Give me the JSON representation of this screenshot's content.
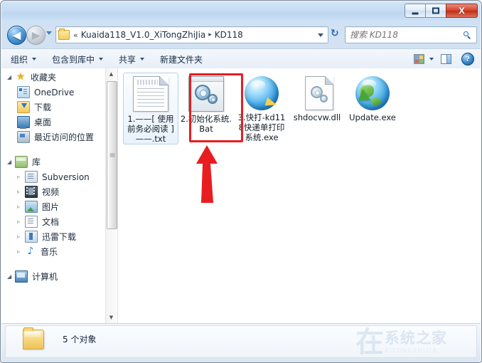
{
  "window": {
    "title": "",
    "controls": {
      "minimize": "–",
      "maximize": "□",
      "close": "X"
    }
  },
  "address_bar": {
    "back_tooltip": "←",
    "back_glyph": "◀",
    "forward_glyph": "▶",
    "history_dropdown": "▼",
    "breadcrumb_prefix": "«",
    "breadcrumb": [
      "Kuaida118_V1.0_XiTongZhiJia",
      "KD118"
    ],
    "breadcrumb_separator": "▸",
    "refresh_glyph": "↻",
    "search": {
      "placeholder": "搜索 KD118",
      "value": ""
    }
  },
  "toolbar": {
    "items": [
      {
        "label": "组织",
        "has_dropdown": true
      },
      {
        "label": "包含到库中",
        "has_dropdown": true
      },
      {
        "label": "共享",
        "has_dropdown": true
      },
      {
        "label": "新建文件夹",
        "has_dropdown": false
      }
    ],
    "view_button": "view-icon",
    "pane_button": "preview-pane-icon",
    "help_button": "?"
  },
  "sidebar": {
    "groups": [
      {
        "label": "收藏夹",
        "expander": "◢",
        "icon": "star-icon",
        "items": [
          {
            "label": "OneDrive",
            "icon": "onedrive-icon",
            "expander": ""
          },
          {
            "label": "下载",
            "icon": "downloads-icon",
            "expander": ""
          },
          {
            "label": "桌面",
            "icon": "desktop-icon",
            "expander": ""
          },
          {
            "label": "最近访问的位置",
            "icon": "recent-places-icon",
            "expander": ""
          }
        ]
      },
      {
        "label": "库",
        "expander": "◢",
        "icon": "library-icon",
        "items": [
          {
            "label": "Subversion",
            "icon": "subversion-icon",
            "expander": "▹"
          },
          {
            "label": "视频",
            "icon": "videos-icon",
            "expander": "▹"
          },
          {
            "label": "图片",
            "icon": "pictures-icon",
            "expander": "▹"
          },
          {
            "label": "文档",
            "icon": "documents-icon",
            "expander": "▹"
          },
          {
            "label": "迅雷下载",
            "icon": "thunder-download-icon",
            "expander": "▹"
          },
          {
            "label": "音乐",
            "icon": "music-icon",
            "expander": "▹"
          }
        ]
      },
      {
        "label": "计算机",
        "expander": "◢",
        "icon": "computer-icon",
        "items": []
      }
    ],
    "scrollbar": {
      "up_glyph": "▲",
      "down_glyph": "▼"
    }
  },
  "files": [
    {
      "name": "1.——[ 使用前务必阅读 ]——.txt",
      "icon": "text-file-icon",
      "selected": true,
      "highlighted": false
    },
    {
      "name": "2.初始化系统.Bat",
      "icon": "batch-file-icon",
      "selected": false,
      "highlighted": true
    },
    {
      "name": "3.快打-kd118快递单打印系统.exe",
      "icon": "kd118-app-icon",
      "selected": false,
      "highlighted": false
    },
    {
      "name": "shdocvw.dll",
      "icon": "dll-file-icon",
      "selected": false,
      "highlighted": false
    },
    {
      "name": "Update.exe",
      "icon": "update-app-icon",
      "selected": false,
      "highlighted": false
    }
  ],
  "annotation": {
    "highlight_color": "#e81d20",
    "arrow_color": "#e81d20",
    "target": "2.初始化系统.Bat"
  },
  "status_bar": {
    "icon": "folder-icon",
    "text": "5 个对象"
  },
  "watermark": {
    "mark": "在",
    "chinese": "系统之家",
    "english": "XITONGZHIJIA"
  }
}
